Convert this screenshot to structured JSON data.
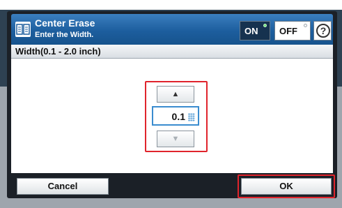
{
  "header": {
    "title": "Center Erase",
    "subtitle": "Enter the Width.",
    "on_label": "ON",
    "off_label": "OFF",
    "help_label": "?"
  },
  "field": {
    "label": "Width(0.1 - 2.0 inch)",
    "value": "0.1",
    "up_glyph": "▲",
    "down_glyph": "▼"
  },
  "footer": {
    "cancel_label": "Cancel",
    "ok_label": "OK"
  },
  "icons": [
    "center-erase-icon",
    "help-icon",
    "up-arrow-icon",
    "down-arrow-icon",
    "keypad-icon"
  ],
  "colors": {
    "title_bar": "#1d5e9e",
    "highlight": "#e0242c",
    "field_border": "#3a8ccf",
    "on_indicator": "#6fe07a"
  },
  "toggle_state": "ON"
}
